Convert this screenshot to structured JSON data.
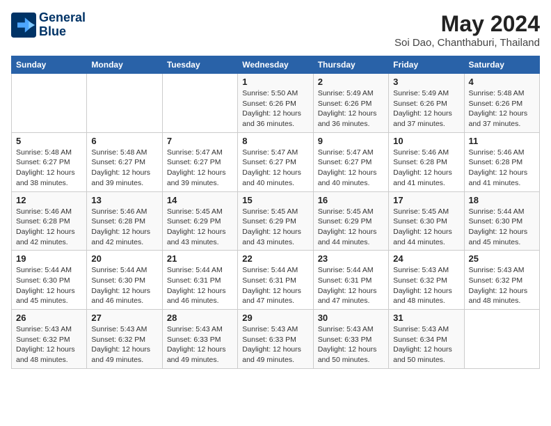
{
  "header": {
    "logo_line1": "General",
    "logo_line2": "Blue",
    "title": "May 2024",
    "subtitle": "Soi Dao, Chanthaburi, Thailand"
  },
  "calendar": {
    "headers": [
      "Sunday",
      "Monday",
      "Tuesday",
      "Wednesday",
      "Thursday",
      "Friday",
      "Saturday"
    ],
    "weeks": [
      [
        {
          "day": "",
          "info": ""
        },
        {
          "day": "",
          "info": ""
        },
        {
          "day": "",
          "info": ""
        },
        {
          "day": "1",
          "info": "Sunrise: 5:50 AM\nSunset: 6:26 PM\nDaylight: 12 hours\nand 36 minutes."
        },
        {
          "day": "2",
          "info": "Sunrise: 5:49 AM\nSunset: 6:26 PM\nDaylight: 12 hours\nand 36 minutes."
        },
        {
          "day": "3",
          "info": "Sunrise: 5:49 AM\nSunset: 6:26 PM\nDaylight: 12 hours\nand 37 minutes."
        },
        {
          "day": "4",
          "info": "Sunrise: 5:48 AM\nSunset: 6:26 PM\nDaylight: 12 hours\nand 37 minutes."
        }
      ],
      [
        {
          "day": "5",
          "info": "Sunrise: 5:48 AM\nSunset: 6:27 PM\nDaylight: 12 hours\nand 38 minutes."
        },
        {
          "day": "6",
          "info": "Sunrise: 5:48 AM\nSunset: 6:27 PM\nDaylight: 12 hours\nand 39 minutes."
        },
        {
          "day": "7",
          "info": "Sunrise: 5:47 AM\nSunset: 6:27 PM\nDaylight: 12 hours\nand 39 minutes."
        },
        {
          "day": "8",
          "info": "Sunrise: 5:47 AM\nSunset: 6:27 PM\nDaylight: 12 hours\nand 40 minutes."
        },
        {
          "day": "9",
          "info": "Sunrise: 5:47 AM\nSunset: 6:27 PM\nDaylight: 12 hours\nand 40 minutes."
        },
        {
          "day": "10",
          "info": "Sunrise: 5:46 AM\nSunset: 6:28 PM\nDaylight: 12 hours\nand 41 minutes."
        },
        {
          "day": "11",
          "info": "Sunrise: 5:46 AM\nSunset: 6:28 PM\nDaylight: 12 hours\nand 41 minutes."
        }
      ],
      [
        {
          "day": "12",
          "info": "Sunrise: 5:46 AM\nSunset: 6:28 PM\nDaylight: 12 hours\nand 42 minutes."
        },
        {
          "day": "13",
          "info": "Sunrise: 5:46 AM\nSunset: 6:28 PM\nDaylight: 12 hours\nand 42 minutes."
        },
        {
          "day": "14",
          "info": "Sunrise: 5:45 AM\nSunset: 6:29 PM\nDaylight: 12 hours\nand 43 minutes."
        },
        {
          "day": "15",
          "info": "Sunrise: 5:45 AM\nSunset: 6:29 PM\nDaylight: 12 hours\nand 43 minutes."
        },
        {
          "day": "16",
          "info": "Sunrise: 5:45 AM\nSunset: 6:29 PM\nDaylight: 12 hours\nand 44 minutes."
        },
        {
          "day": "17",
          "info": "Sunrise: 5:45 AM\nSunset: 6:30 PM\nDaylight: 12 hours\nand 44 minutes."
        },
        {
          "day": "18",
          "info": "Sunrise: 5:44 AM\nSunset: 6:30 PM\nDaylight: 12 hours\nand 45 minutes."
        }
      ],
      [
        {
          "day": "19",
          "info": "Sunrise: 5:44 AM\nSunset: 6:30 PM\nDaylight: 12 hours\nand 45 minutes."
        },
        {
          "day": "20",
          "info": "Sunrise: 5:44 AM\nSunset: 6:30 PM\nDaylight: 12 hours\nand 46 minutes."
        },
        {
          "day": "21",
          "info": "Sunrise: 5:44 AM\nSunset: 6:31 PM\nDaylight: 12 hours\nand 46 minutes."
        },
        {
          "day": "22",
          "info": "Sunrise: 5:44 AM\nSunset: 6:31 PM\nDaylight: 12 hours\nand 47 minutes."
        },
        {
          "day": "23",
          "info": "Sunrise: 5:44 AM\nSunset: 6:31 PM\nDaylight: 12 hours\nand 47 minutes."
        },
        {
          "day": "24",
          "info": "Sunrise: 5:43 AM\nSunset: 6:32 PM\nDaylight: 12 hours\nand 48 minutes."
        },
        {
          "day": "25",
          "info": "Sunrise: 5:43 AM\nSunset: 6:32 PM\nDaylight: 12 hours\nand 48 minutes."
        }
      ],
      [
        {
          "day": "26",
          "info": "Sunrise: 5:43 AM\nSunset: 6:32 PM\nDaylight: 12 hours\nand 48 minutes."
        },
        {
          "day": "27",
          "info": "Sunrise: 5:43 AM\nSunset: 6:32 PM\nDaylight: 12 hours\nand 49 minutes."
        },
        {
          "day": "28",
          "info": "Sunrise: 5:43 AM\nSunset: 6:33 PM\nDaylight: 12 hours\nand 49 minutes."
        },
        {
          "day": "29",
          "info": "Sunrise: 5:43 AM\nSunset: 6:33 PM\nDaylight: 12 hours\nand 49 minutes."
        },
        {
          "day": "30",
          "info": "Sunrise: 5:43 AM\nSunset: 6:33 PM\nDaylight: 12 hours\nand 50 minutes."
        },
        {
          "day": "31",
          "info": "Sunrise: 5:43 AM\nSunset: 6:34 PM\nDaylight: 12 hours\nand 50 minutes."
        },
        {
          "day": "",
          "info": ""
        }
      ]
    ]
  }
}
